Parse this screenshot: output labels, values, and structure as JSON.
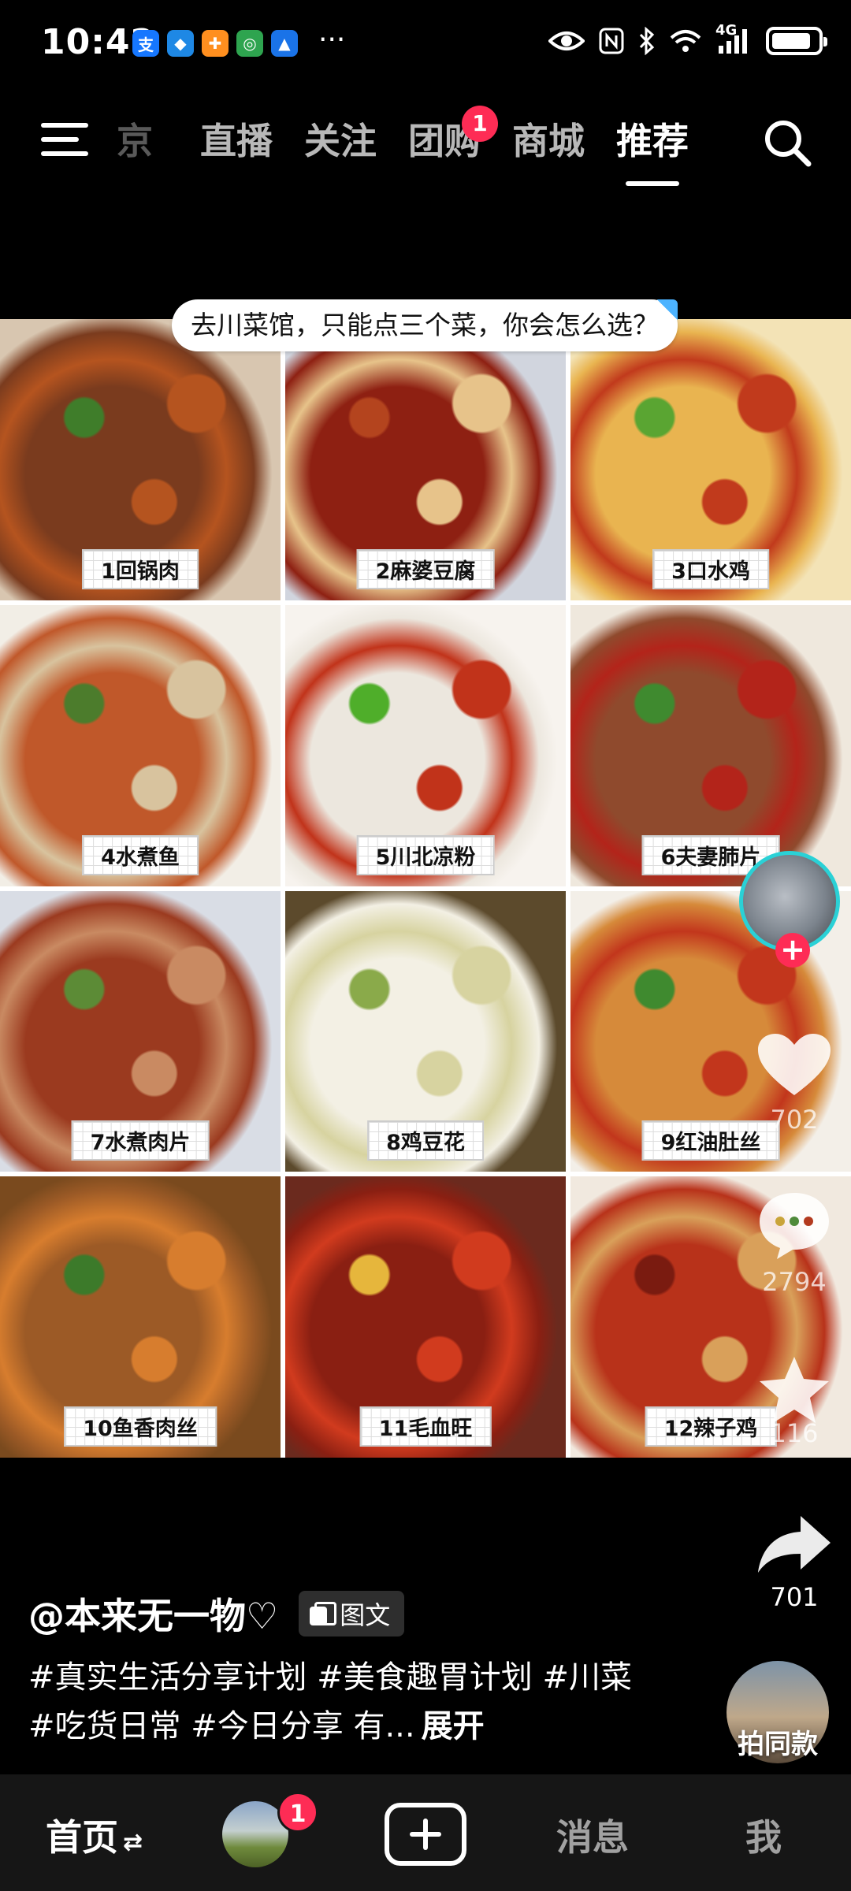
{
  "status_bar": {
    "time": "10:42",
    "apps": [
      {
        "name": "alipay-icon",
        "glyph": "支",
        "color": "#1677ff"
      },
      {
        "name": "shield-app-icon",
        "glyph": "◆",
        "color": "#1e88e5"
      },
      {
        "name": "orange-app-icon",
        "glyph": "✚",
        "color": "#ff8f1f"
      },
      {
        "name": "green-app-icon",
        "glyph": "◎",
        "color": "#2ea44f"
      },
      {
        "name": "bank-app-icon",
        "glyph": "▲",
        "color": "#1a73e8"
      }
    ],
    "more": "···",
    "network": "4G",
    "battery_level": 0.85
  },
  "top_nav": {
    "tabs": [
      {
        "label": "京",
        "state": "faded"
      },
      {
        "label": "直播",
        "state": "normal"
      },
      {
        "label": "关注",
        "state": "normal"
      },
      {
        "label": "团购",
        "state": "normal",
        "badge": "1"
      },
      {
        "label": "商城",
        "state": "normal"
      },
      {
        "label": "推荐",
        "state": "active"
      }
    ]
  },
  "post": {
    "caption": "去川菜馆，只能点三个菜，你会怎么选？",
    "dishes": [
      {
        "label": "1回锅肉",
        "colors": [
          "#7a3b1e",
          "#b5541f",
          "#3f7d2a",
          "#d8c6b0"
        ]
      },
      {
        "label": "2麻婆豆腐",
        "colors": [
          "#8e2012",
          "#e7c38a",
          "#b4441e",
          "#d1d5de"
        ]
      },
      {
        "label": "3口水鸡",
        "colors": [
          "#e9b450",
          "#c13a1c",
          "#5aa532",
          "#f3e3b6"
        ]
      },
      {
        "label": "4水煮鱼",
        "colors": [
          "#c0582a",
          "#d8c39e",
          "#4c7c2c",
          "#f2eee6"
        ]
      },
      {
        "label": "5川北凉粉",
        "colors": [
          "#ece7de",
          "#c1331a",
          "#4fae2a",
          "#f7f3ee"
        ]
      },
      {
        "label": "6夫妻肺片",
        "colors": [
          "#8f4a2d",
          "#b3241a",
          "#3f8a2f",
          "#efe8dd"
        ]
      },
      {
        "label": "7水煮肉片",
        "colors": [
          "#9b3a1f",
          "#c98a62",
          "#5c8b36",
          "#d9dde5"
        ]
      },
      {
        "label": "8鸡豆花",
        "colors": [
          "#f3f0e4",
          "#d7d3a0",
          "#8aaa4a",
          "#5c4a2c"
        ]
      },
      {
        "label": "9红油肚丝",
        "colors": [
          "#d68a3a",
          "#c2361c",
          "#3f8a2f",
          "#f3efe8"
        ]
      },
      {
        "label": "10鱼香肉丝",
        "colors": [
          "#9c5a26",
          "#d77d2e",
          "#3c7a2a",
          "#7a4a1e"
        ]
      },
      {
        "label": "11毛血旺",
        "colors": [
          "#8a1f12",
          "#d13b1e",
          "#e6b63c",
          "#6b2a1e"
        ]
      },
      {
        "label": "12辣子鸡",
        "colors": [
          "#b8321a",
          "#d9a05a",
          "#7a1b10",
          "#f1e9df"
        ]
      }
    ]
  },
  "actions": {
    "like_count": "702",
    "comment_count": "2794",
    "favorite_count": "116",
    "share_count": "701"
  },
  "info": {
    "author": "@本来无一物♡",
    "post_type": "图文",
    "description": "#真实生活分享计划 #美食趣胃计划 #川菜 #吃货日常 #今日分享 有...",
    "expand": "展开",
    "same_style": "拍同款"
  },
  "tab_bar": {
    "home": "首页",
    "home_switch": "⇄",
    "friends_badge": "1",
    "messages": "消息",
    "me": "我"
  }
}
